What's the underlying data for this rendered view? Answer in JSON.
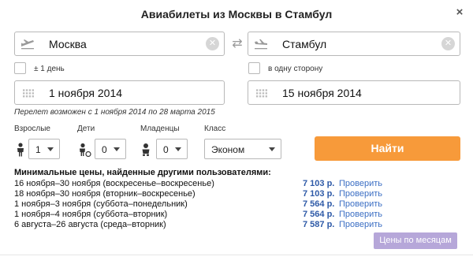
{
  "dialog": {
    "title": "Авиабилеты из Москвы в Стамбул",
    "close_label": "×"
  },
  "search": {
    "from": "Москва",
    "to": "Стамбул",
    "plus_one_day_label": "± 1 день",
    "one_way_label": "в одну сторону",
    "depart_date": "1 ноября 2014",
    "return_date": "15 ноября 2014",
    "range_note": "Перелет возможен с 1 ноября 2014 по 28 марта 2015"
  },
  "passengers": {
    "adults": {
      "label": "Взрослые",
      "value": "1"
    },
    "children": {
      "label": "Дети",
      "value": "0"
    },
    "infants": {
      "label": "Младенцы",
      "value": "0"
    },
    "class": {
      "label": "Класс",
      "value": "Эконом"
    }
  },
  "find_button": "Найти",
  "min_prices": {
    "title": "Минимальные цены, найденные другими пользователями:",
    "check_label": "Проверить",
    "rows": [
      {
        "dates": "16 ноября–30 ноября (воскресенье–воскресенье)",
        "price": "7 103 р."
      },
      {
        "dates": "18 ноября–30 ноября (вторник–воскресенье)",
        "price": "7 103 р."
      },
      {
        "dates": "1 ноября–3 ноября (суббота–понедельник)",
        "price": "7 564 р."
      },
      {
        "dates": "1 ноября–4 ноября (суббота–вторник)",
        "price": "7 564 р."
      },
      {
        "dates": "6 августа–26 августа (среда–вторник)",
        "price": "7 587 р."
      }
    ]
  },
  "month_prices_button": "Цены по месяцам",
  "colors": {
    "accent_orange": "#f79a3a",
    "price_blue": "#2e5aa7",
    "link_blue": "#3c6fc4",
    "month_button": "#b6a7d9"
  }
}
